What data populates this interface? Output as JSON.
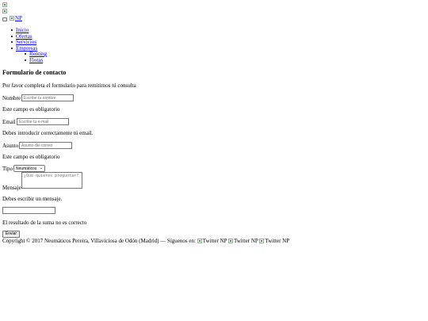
{
  "header": {
    "logo_alt": "NP"
  },
  "nav": {
    "items": [
      {
        "label": "Inicio"
      },
      {
        "label": "Ofertas"
      },
      {
        "label": "Servicios"
      },
      {
        "label": "Empresas"
      }
    ],
    "subitems": [
      {
        "label": "Renting"
      },
      {
        "label": "Flotas"
      }
    ]
  },
  "form": {
    "title": "Formulario de contacto",
    "intro": "Por favor completa el formulario para remitirnos tú consulta",
    "name_label": "Nombre",
    "name_placeholder": "Escribe tu nombre",
    "name_error": "Este campo es obligatorio",
    "email_label": "Email",
    "email_placeholder": "Escribe tu e-mail",
    "email_error": "Debes introducir correctamente tú email.",
    "subject_label": "Asunto",
    "subject_placeholder": "Asunto del correo",
    "subject_error": "Este campo es obligatorio",
    "type_label": "Tipo",
    "type_selected": "Neumáticos",
    "message_label": "Mensaje",
    "message_placeholder": "¿Que quieres preguntar?",
    "message_error": "Debes escribir un mensaje.",
    "sum_value": "",
    "sum_error": "El resultado de la suma no es correcto",
    "submit_label": "Enviar"
  },
  "footer": {
    "copyright": "Copyright © 2017 Neumáticos Pereira, Villaviciosa de Odón (Madrid) — Síguenos en:",
    "social_alts": [
      "Twitter NP",
      "Twitter NP",
      "Twitter NP"
    ]
  }
}
